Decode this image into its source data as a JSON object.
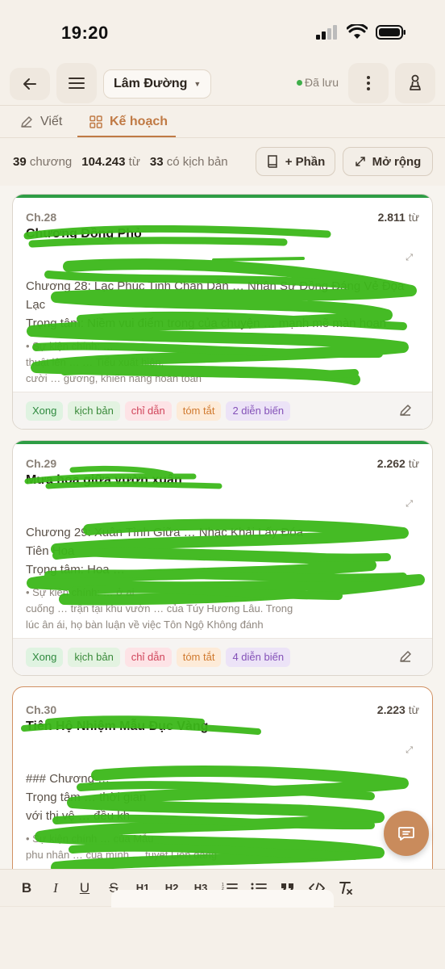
{
  "status_bar": {
    "time": "19:20"
  },
  "header": {
    "doc_name": "Lâm Đường",
    "saved_label": "Đã lưu"
  },
  "tabs": [
    {
      "label": "Viết"
    },
    {
      "label": "Kế hoạch"
    }
  ],
  "stats": {
    "chapters_count": "39",
    "chapters_label": "chương",
    "words_count": "104.243",
    "words_label": "từ",
    "scripts_count": "33",
    "scripts_label": "có kịch bản"
  },
  "actions": {
    "add_part": "+ Phần",
    "expand": "Mở rộng"
  },
  "chapters": [
    {
      "num": "Ch.28",
      "words": "2.811",
      "words_unit": "từ",
      "title": "Chương Đồng Phỏ",
      "summary_lines": [
        "Chương 28: Lạc Phúc Tinh Chân Dẫn … Nhân Sư Đồng Đáng Vẻ Đọa",
        "Lạc",
        "Trọng tâm: Niềm vui điểm trong của chuyện … mạnh mẽ màn hoan"
      ],
      "event_lines": [
        "• Sự kiện chính: …",
        "thuật lên …                       … Tiểu xuất hiện,",
        "cười … gương, khiến nàng hoàn toàn"
      ],
      "tags": [
        "Xong",
        "kịch bản",
        "chỉ dẫn",
        "tóm tắt",
        "2 diễn biến"
      ]
    },
    {
      "num": "Ch.29",
      "words": "2.262",
      "words_unit": "từ",
      "title": "Mưa hoa giữa vườn xuân",
      "summary_lines": [
        "Chương 29: Xuân Tình Giữa … Nhạc Khải Lấy Đóa",
        "Tiên Hoa",
        "Trọng tâm: Hoa …"
      ],
      "event_lines": [
        "• Sự kiện chính: …                                         ở ai",
        "cuống … trận tại khu vườn … của Túy Hương Lâu. Trong",
        "lúc ân ái, họ bàn luận về việc Tôn Ngộ Không đánh"
      ],
      "tags": [
        "Xong",
        "kịch bản",
        "chỉ dẫn",
        "tóm tắt",
        "4 diễn biến"
      ]
    },
    {
      "num": "Ch.30",
      "words": "2.223",
      "words_unit": "từ",
      "title": "Tiên Hộ Nhiệm Mẫu Đục Vàng",
      "summary_lines": [
        "### Chương …",
        "Trọng tâm …                                           thời gian",
        "với thị vệ … đều kh"
      ],
      "event_lines": [
        "• Sự kiện chính …                                    của Mẫu",
        "phu nhân …                  của mình … tuyệt Liên dâng"
      ],
      "tags": []
    }
  ],
  "format_toolbar": {
    "bold": "B",
    "italic": "I",
    "underline": "U",
    "strike": "S",
    "h1": "H1",
    "h2": "H2",
    "h3": "H3"
  },
  "colors": {
    "accent": "#c07a45",
    "done_bar": "#2e9d45",
    "scribble": "#3cb81a"
  }
}
